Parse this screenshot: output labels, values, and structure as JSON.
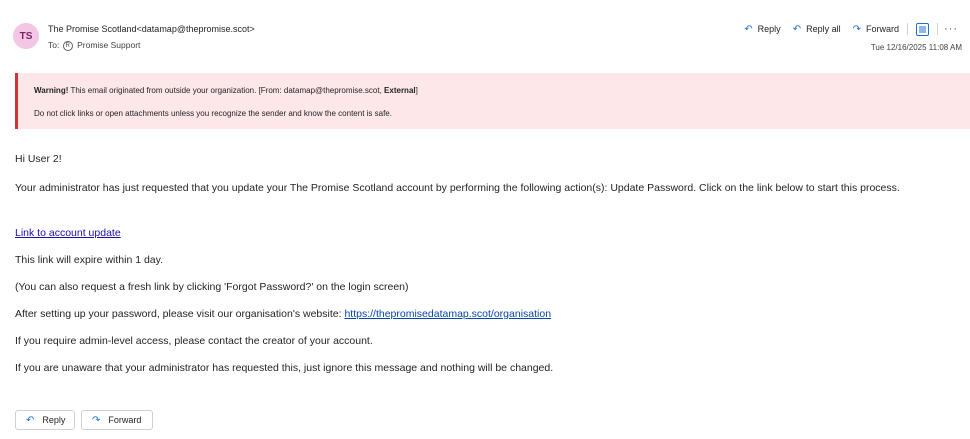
{
  "email": {
    "sender_initials": "TS",
    "sender": "The Promise Scotland<datamap@thepromise.scot>",
    "to_prefix": "To:",
    "to_icon": "R",
    "recipient": "Promise Support",
    "timestamp": "Tue 12/16/2025 11:08 AM"
  },
  "actions": {
    "reply": "Reply",
    "reply_all": "Reply all",
    "forward": "Forward",
    "more": "···"
  },
  "warning": {
    "bold": "Warning!",
    "line1_text": " This email originated from outside your organization. [From: datamap@thepromise.scot, ",
    "line1_bold_end": "External",
    "line1_close": "]",
    "line2": "Do not click links or open attachments unless you recognize the sender and know the content is safe.",
    "accent_color": "#d13438",
    "background_color": "#fde7e9"
  },
  "body": {
    "greeting": "Hi User 2!",
    "para1": "Your administrator has just requested that you update your The Promise Scotland account by performing the following action(s): Update Password. Click on the link below to start this process.",
    "link_label": "Link to account update",
    "expire": "This link will expire within 1 day.",
    "fresh": "(You can also request a fresh link by clicking 'Forgot Password?' on the login screen)",
    "after_prefix": "After setting up your password, please visit our organisation's website: ",
    "after_link": "https://thepromisedatamap.scot/organisation",
    "admin": "If you require admin-level access, please contact the creator of your account.",
    "unaware": "If you are unaware that your administrator has requested this, just ignore this message and nothing will be changed."
  },
  "footer": {
    "reply": "Reply",
    "forward": "Forward"
  }
}
